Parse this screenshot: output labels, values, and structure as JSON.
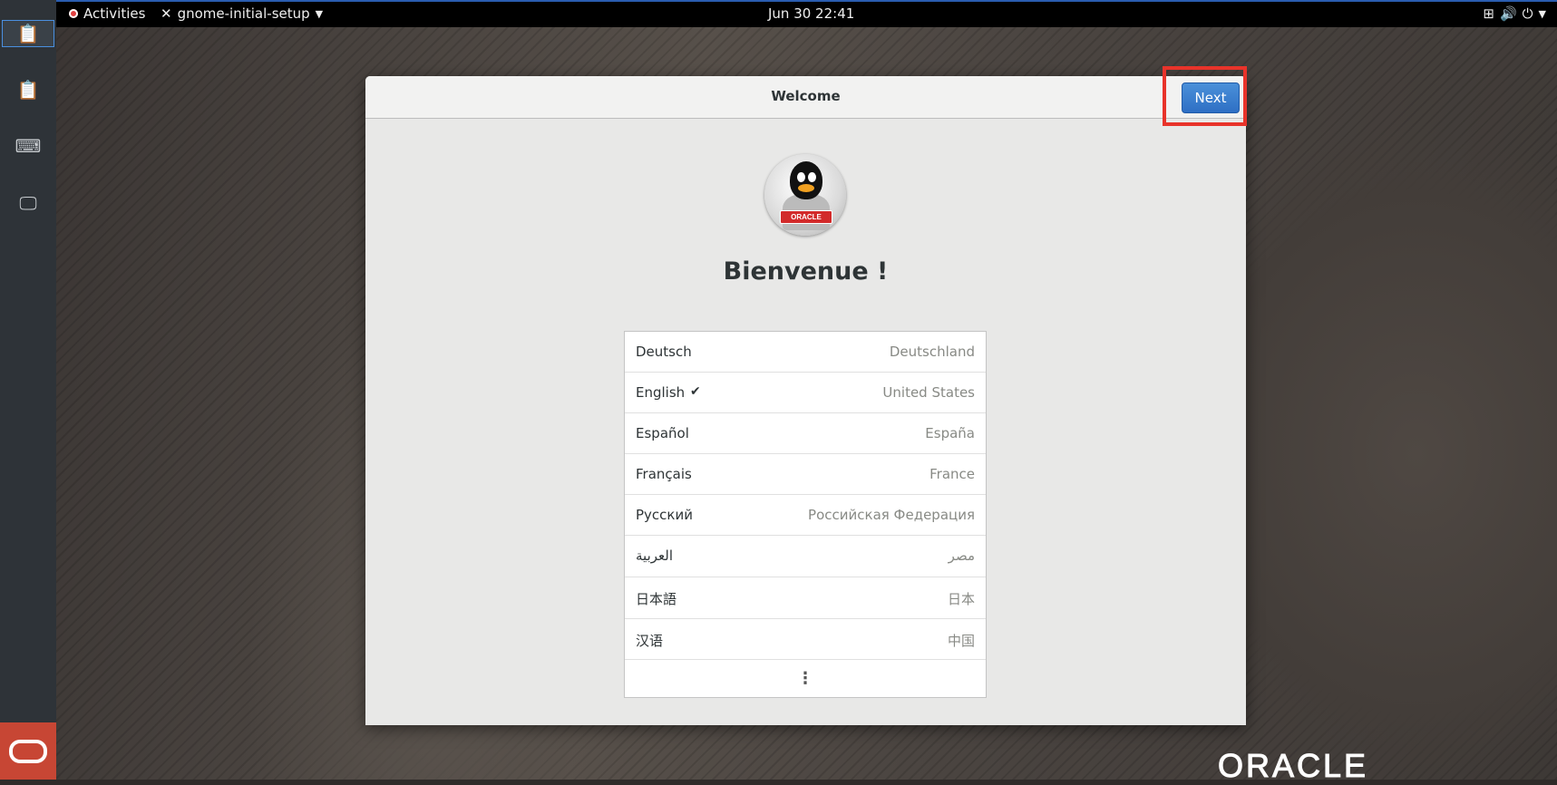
{
  "topbar": {
    "activities": "Activities",
    "app_name": "gnome-initial-setup",
    "clock": "Jun 30  22:41"
  },
  "window": {
    "title": "Welcome",
    "next_label": "Next",
    "heading": "Bienvenue !",
    "avatar_badge": "ORACLE"
  },
  "languages": [
    {
      "name": "Deutsch",
      "region": "Deutschland",
      "selected": false
    },
    {
      "name": "English",
      "region": "United States",
      "selected": true
    },
    {
      "name": "Español",
      "region": "España",
      "selected": false
    },
    {
      "name": "Français",
      "region": "France",
      "selected": false
    },
    {
      "name": "Русский",
      "region": "Российская Федерация",
      "selected": false
    },
    {
      "name": "العربية",
      "region": "مصر",
      "selected": false
    },
    {
      "name": "日本語",
      "region": "日本",
      "selected": false
    },
    {
      "name": "汉语",
      "region": "中国",
      "selected": false
    }
  ],
  "check_mark": "✔",
  "more_symbol": "⋮",
  "desktop_logo": "ORACLE",
  "colors": {
    "next_button": "#3b7fd4",
    "highlight_box": "#e8332a",
    "oracle_red": "#c74634"
  }
}
